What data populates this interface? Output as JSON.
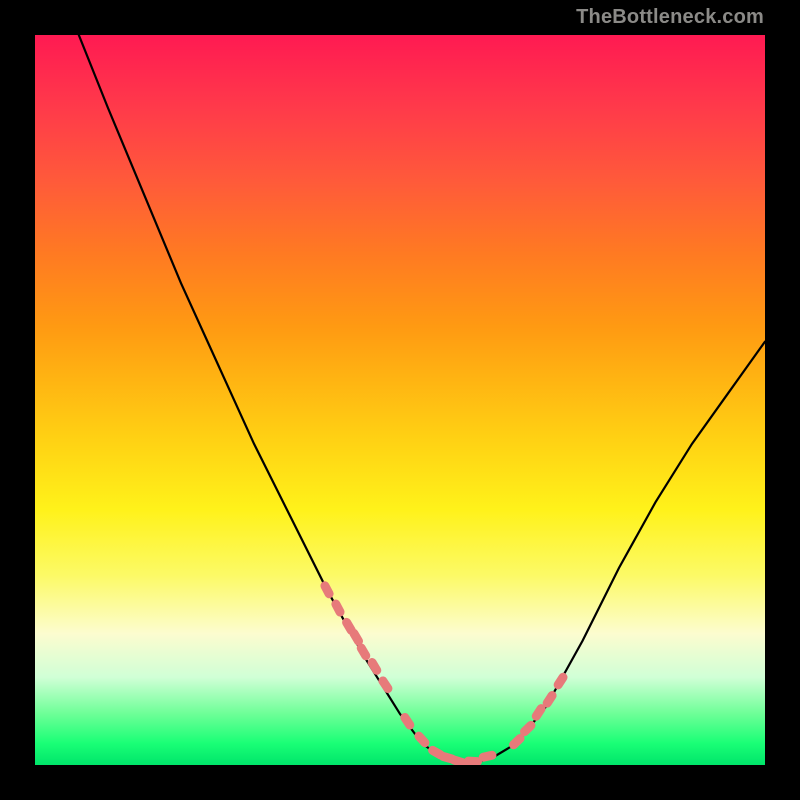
{
  "watermark": "TheBottleneck.com",
  "colors": {
    "background": "#000000",
    "curve": "#000000",
    "dot_fill": "#e77a7a",
    "gradient_top": "#ff1a52",
    "gradient_bottom": "#00e56a"
  },
  "chart_data": {
    "type": "line",
    "title": "",
    "xlabel": "",
    "ylabel": "",
    "xlim": [
      0,
      100
    ],
    "ylim": [
      0,
      100
    ],
    "series": [
      {
        "name": "curve",
        "x": [
          6,
          10,
          15,
          20,
          25,
          30,
          35,
          40,
          45,
          50,
          53,
          55,
          57,
          59,
          61,
          63,
          66,
          70,
          75,
          80,
          85,
          90,
          95,
          100
        ],
        "y": [
          100,
          90,
          78,
          66,
          55,
          44,
          34,
          24,
          15,
          7,
          3,
          1.5,
          0.7,
          0.3,
          0.5,
          1.2,
          3,
          8,
          17,
          27,
          36,
          44,
          51,
          58
        ]
      }
    ],
    "dots": {
      "name": "highlighted-points",
      "x": [
        40,
        41.5,
        43,
        44,
        45,
        46.5,
        48,
        51,
        53,
        55,
        56.5,
        58,
        60,
        62,
        66,
        67.5,
        69,
        70.5,
        72
      ],
      "y": [
        24,
        21.5,
        19,
        17.5,
        15.5,
        13.5,
        11,
        6,
        3.5,
        1.7,
        1.0,
        0.5,
        0.5,
        1.2,
        3.2,
        5.0,
        7.2,
        9.0,
        11.5
      ]
    }
  }
}
